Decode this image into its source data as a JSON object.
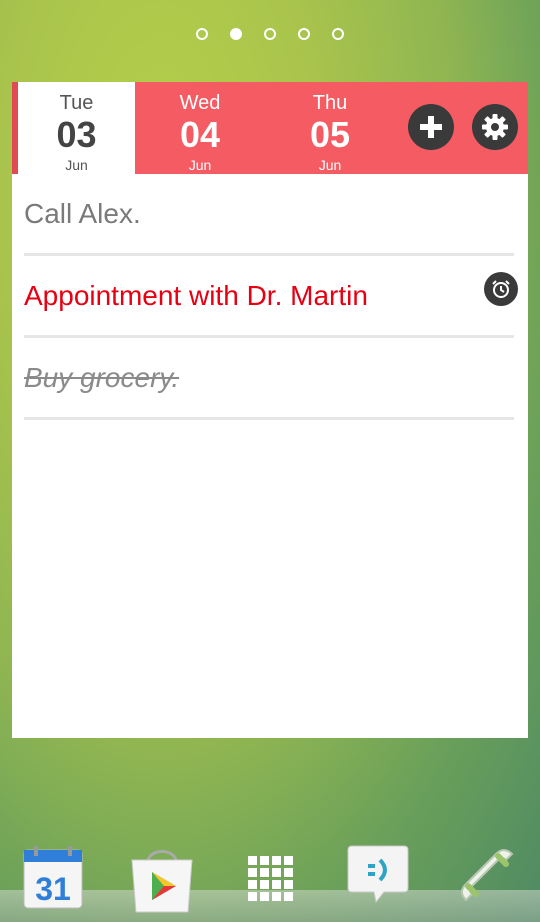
{
  "pager": {
    "count": 5,
    "active_index": 1
  },
  "date_bar": {
    "days": [
      {
        "weekday": "Tue",
        "day": "03",
        "month": "Jun",
        "selected": true
      },
      {
        "weekday": "Wed",
        "day": "04",
        "month": "Jun",
        "selected": false
      },
      {
        "weekday": "Thu",
        "day": "05",
        "month": "Jun",
        "selected": false
      }
    ],
    "add_icon": "plus-icon",
    "settings_icon": "gear-icon"
  },
  "tasks": [
    {
      "text": "Call Alex.",
      "status": "normal"
    },
    {
      "text": "Appointment with Dr. Martin",
      "status": "urgent",
      "has_alarm": true
    },
    {
      "text": "Buy grocery.",
      "status": "done"
    }
  ],
  "dock": {
    "calendar_day": "31",
    "icons": [
      "calendar-icon",
      "play-store-icon",
      "app-drawer-icon",
      "messaging-icon",
      "phone-icon"
    ]
  },
  "colors": {
    "accent": "#f45b63",
    "urgent_text": "#e60012"
  }
}
